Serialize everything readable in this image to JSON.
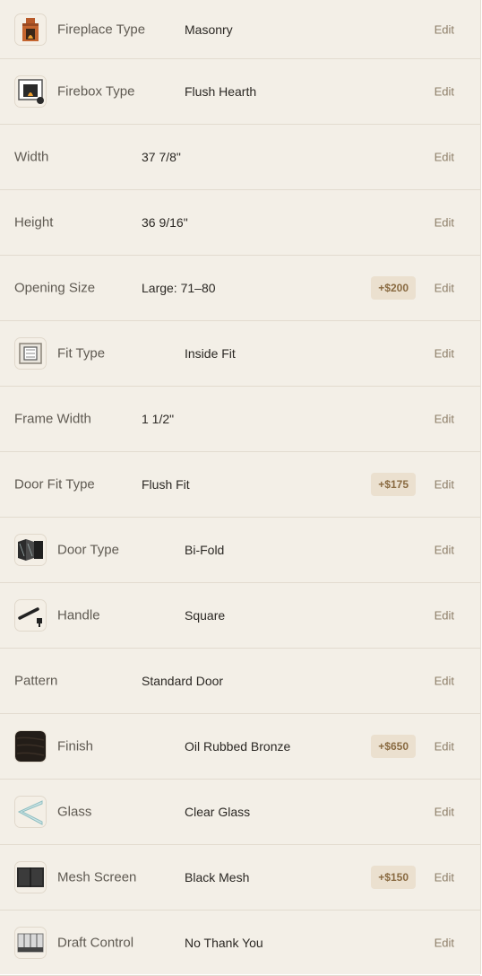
{
  "rows": [
    {
      "label": "Fireplace Type",
      "value": "Masonry",
      "edit": "Edit",
      "icon": "masonry-fireplace-icon"
    },
    {
      "label": "Firebox Type",
      "value": "Flush Hearth",
      "edit": "Edit",
      "icon": "flush-hearth-icon"
    },
    {
      "label": "Width",
      "value": "37 7/8\"",
      "edit": "Edit"
    },
    {
      "label": "Height",
      "value": "36 9/16\"",
      "edit": "Edit"
    },
    {
      "label": "Opening Size",
      "value": "Large: 71–80",
      "badge": "+$200",
      "edit": "Edit"
    },
    {
      "label": "Fit Type",
      "value": "Inside Fit",
      "edit": "Edit",
      "icon": "inside-fit-icon"
    },
    {
      "label": "Frame Width",
      "value": "1 1/2\"",
      "edit": "Edit"
    },
    {
      "label": "Door Fit Type",
      "value": "Flush Fit",
      "badge": "+$175",
      "edit": "Edit"
    },
    {
      "label": "Door Type",
      "value": "Bi-Fold",
      "edit": "Edit",
      "icon": "bifold-door-icon"
    },
    {
      "label": "Handle",
      "value": "Square",
      "edit": "Edit",
      "icon": "handle-icon"
    },
    {
      "label": "Pattern",
      "value": "Standard Door",
      "edit": "Edit"
    },
    {
      "label": "Finish",
      "value": "Oil Rubbed Bronze",
      "badge": "+$650",
      "edit": "Edit",
      "icon": "oil-rubbed-bronze-swatch-icon"
    },
    {
      "label": "Glass",
      "value": "Clear Glass",
      "edit": "Edit",
      "icon": "clear-glass-icon"
    },
    {
      "label": "Mesh Screen",
      "value": "Black Mesh",
      "badge": "+$150",
      "edit": "Edit",
      "icon": "black-mesh-icon"
    },
    {
      "label": "Draft Control",
      "value": "No Thank You",
      "edit": "Edit",
      "icon": "draft-control-icon"
    }
  ]
}
